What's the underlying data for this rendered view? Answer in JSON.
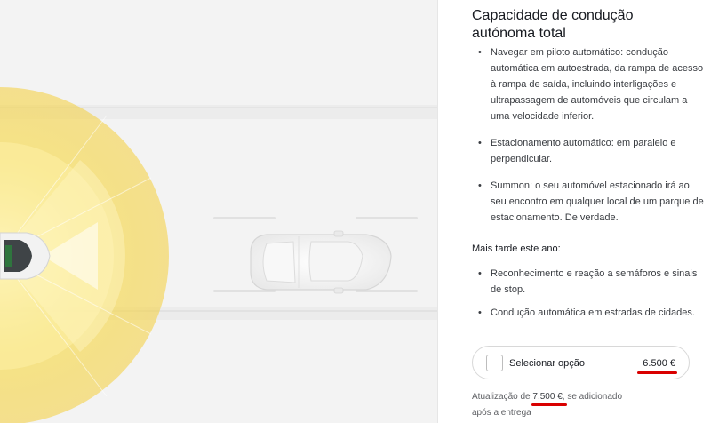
{
  "feature": {
    "title": "Capacidade de condução autónoma total",
    "bullets": [
      "Navegar em piloto automático: condução automática em autoestrada, da rampa de acesso à rampa de saída, incluindo interligações e ultrapassagem de automóveis que circulam a uma velocidade inferior.",
      "Estacionamento automático: em paralelo e perpendicular.",
      "Summon: o seu automóvel estacionado irá ao seu encontro em qualquer local de um parque de estacionamento. De verdade."
    ],
    "later_label": "Mais tarde este ano:",
    "later_bullets": [
      "Reconhecimento e reação a semáforos e sinais de stop.",
      "Condução automática em estradas de cidades."
    ]
  },
  "option": {
    "label": "Selecionar opção",
    "price": "6.500 €",
    "checked": false
  },
  "upgrade": {
    "prefix": "Atualização de",
    "price": "7.500 €",
    "suffix": ", se adicionado",
    "line2": "após a entrega"
  },
  "colors": {
    "sensor_yellow": "#f6d64a",
    "annotation_red": "#d90000",
    "car_white": "#f7f7f7"
  }
}
